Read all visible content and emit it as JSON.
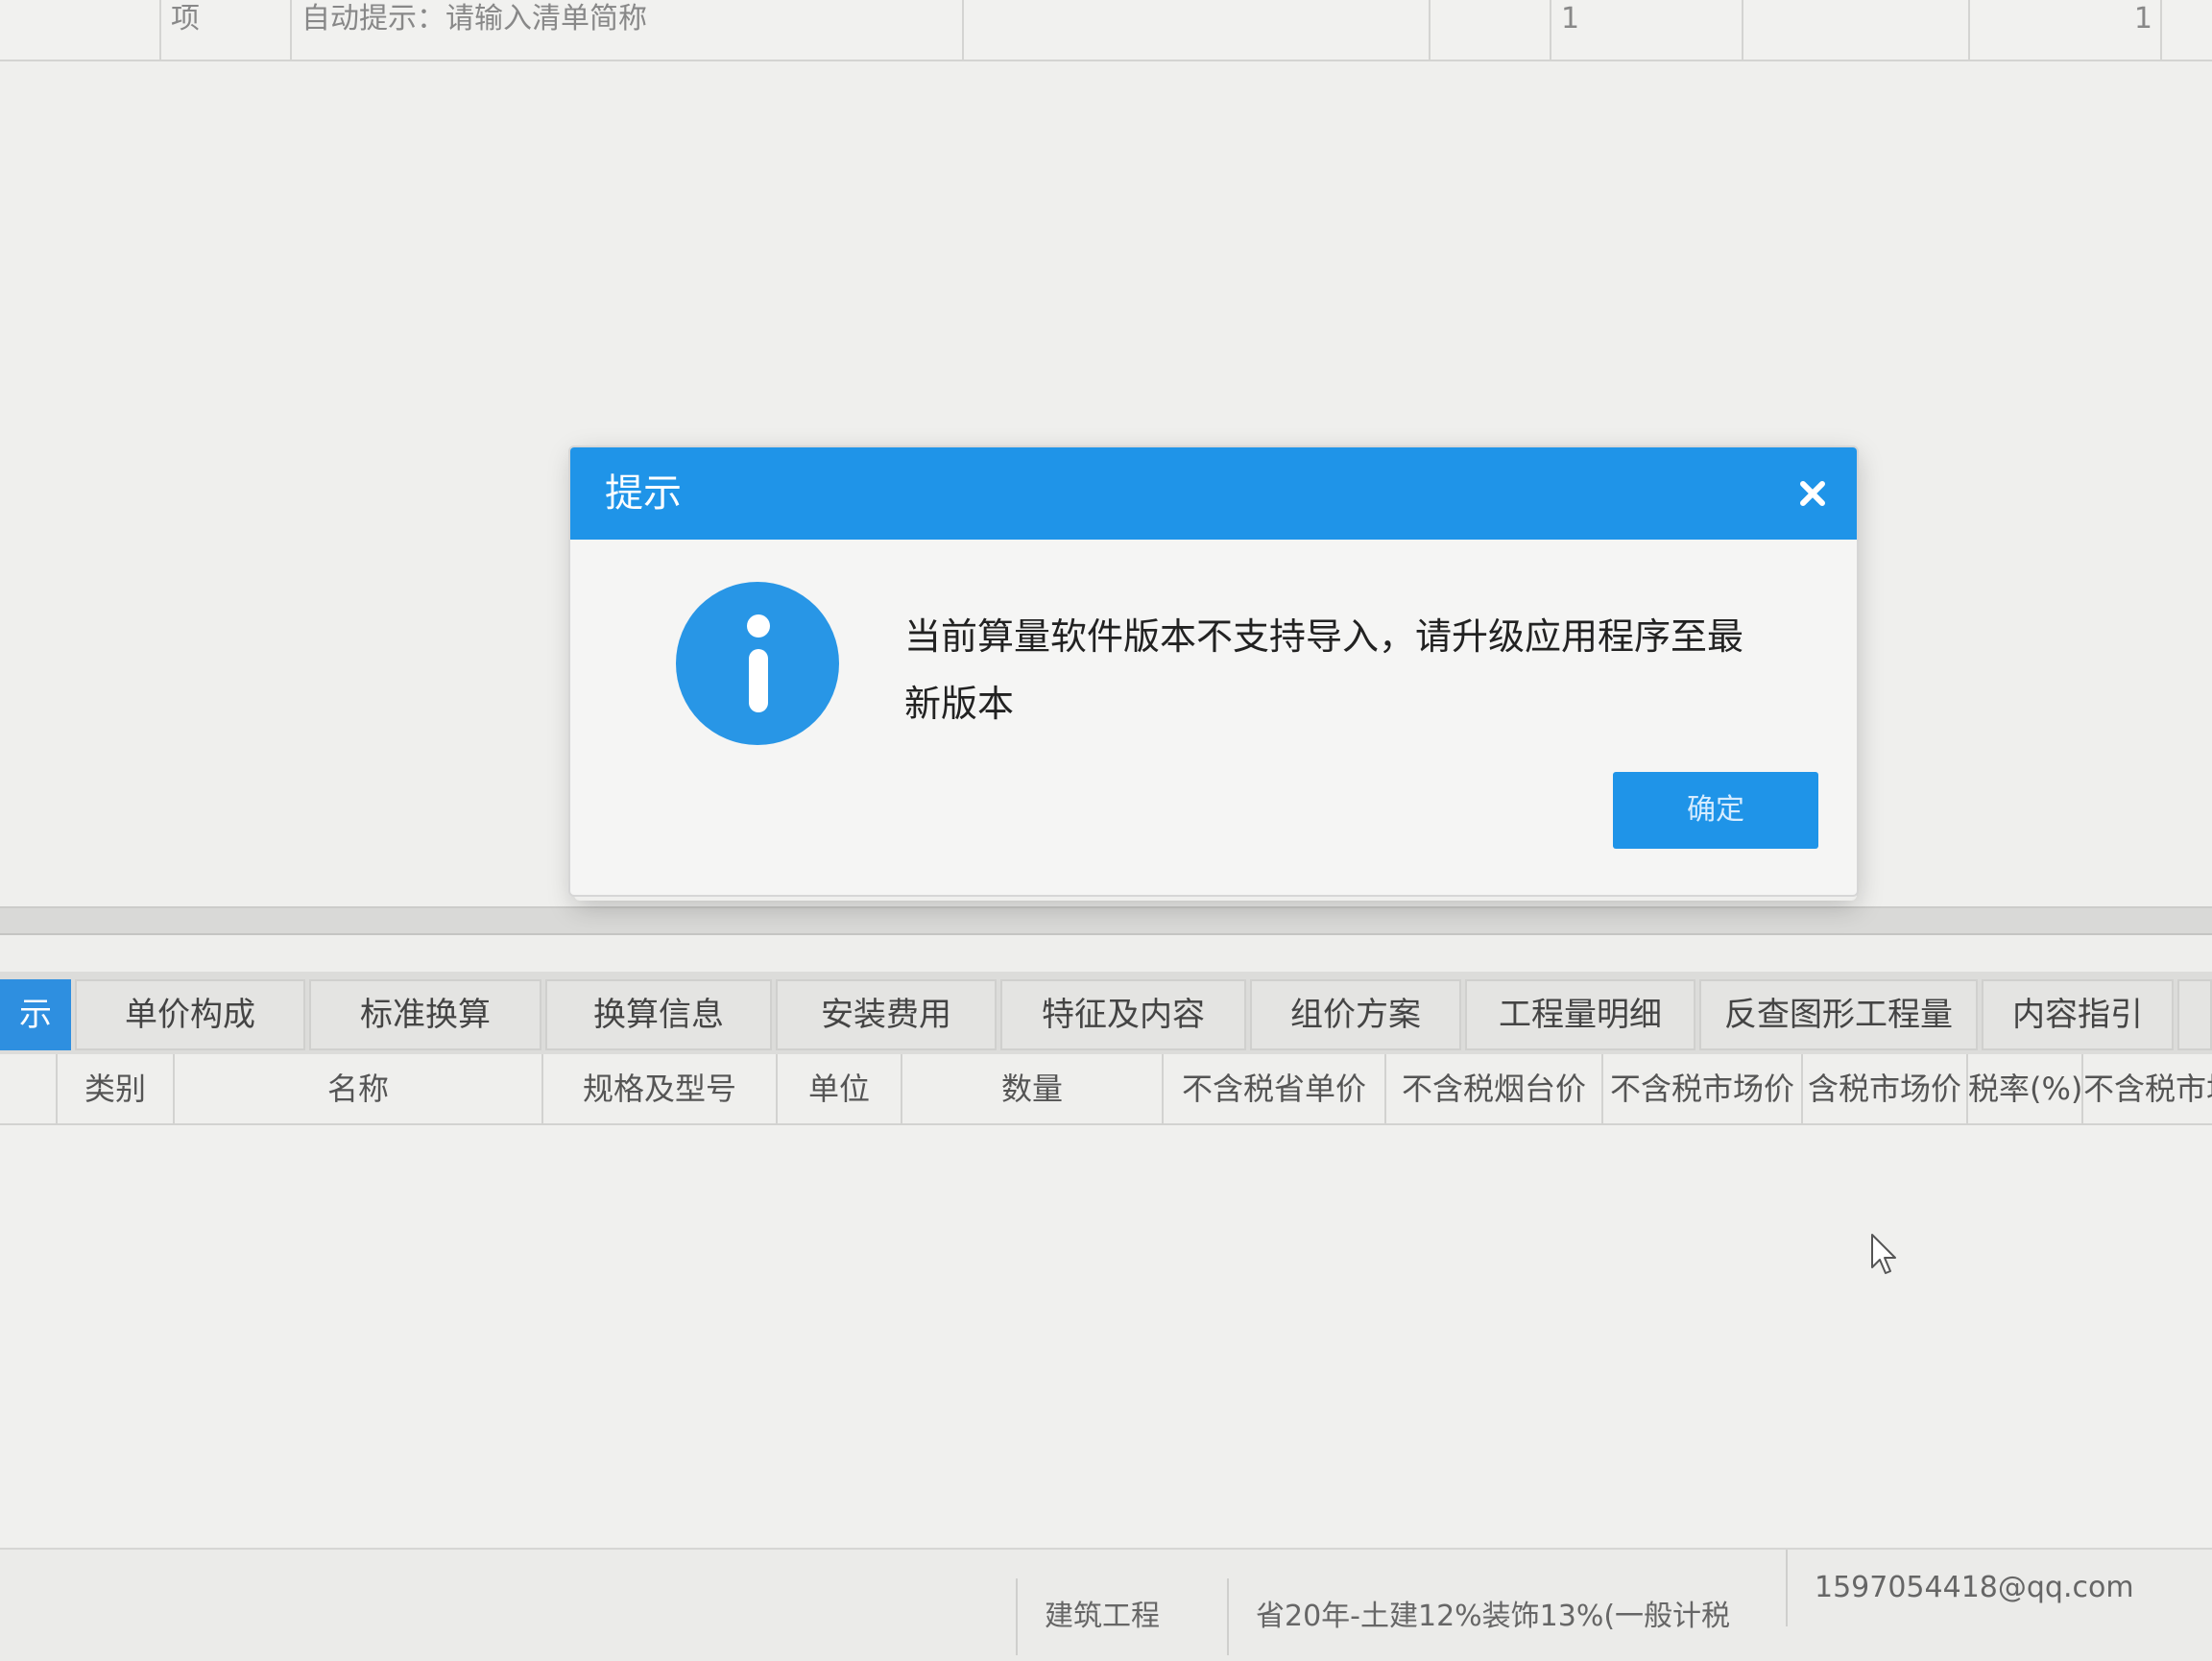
{
  "top_strip": {
    "cell_a": "项",
    "cell_b": "自动提示：请输入清单简称",
    "cell_c": "1",
    "cell_d": "1"
  },
  "dialog": {
    "title": "提示",
    "message": "当前算量软件版本不支持导入，请升级应用程序至最新版本",
    "ok_label": "确定",
    "header_color": "#1f94e8"
  },
  "tabs": [
    {
      "label": "示",
      "active": true
    },
    {
      "label": "单价构成"
    },
    {
      "label": "标准换算"
    },
    {
      "label": "换算信息"
    },
    {
      "label": "安装费用"
    },
    {
      "label": "特征及内容"
    },
    {
      "label": "组价方案"
    },
    {
      "label": "工程量明细"
    },
    {
      "label": "反查图形工程量"
    },
    {
      "label": "内容指引"
    }
  ],
  "columns": [
    "类别",
    "名称",
    "规格及型号",
    "单位",
    "数量",
    "不含税省单价",
    "不含税烟台价",
    "不含税市场价",
    "含税市场价",
    "税率(%)",
    "不含税市场"
  ],
  "status_bar": {
    "project_type": "建筑工程",
    "template": "省20年-土建12%装饰13%(一般计税",
    "user": "1597054418@qq.com"
  }
}
